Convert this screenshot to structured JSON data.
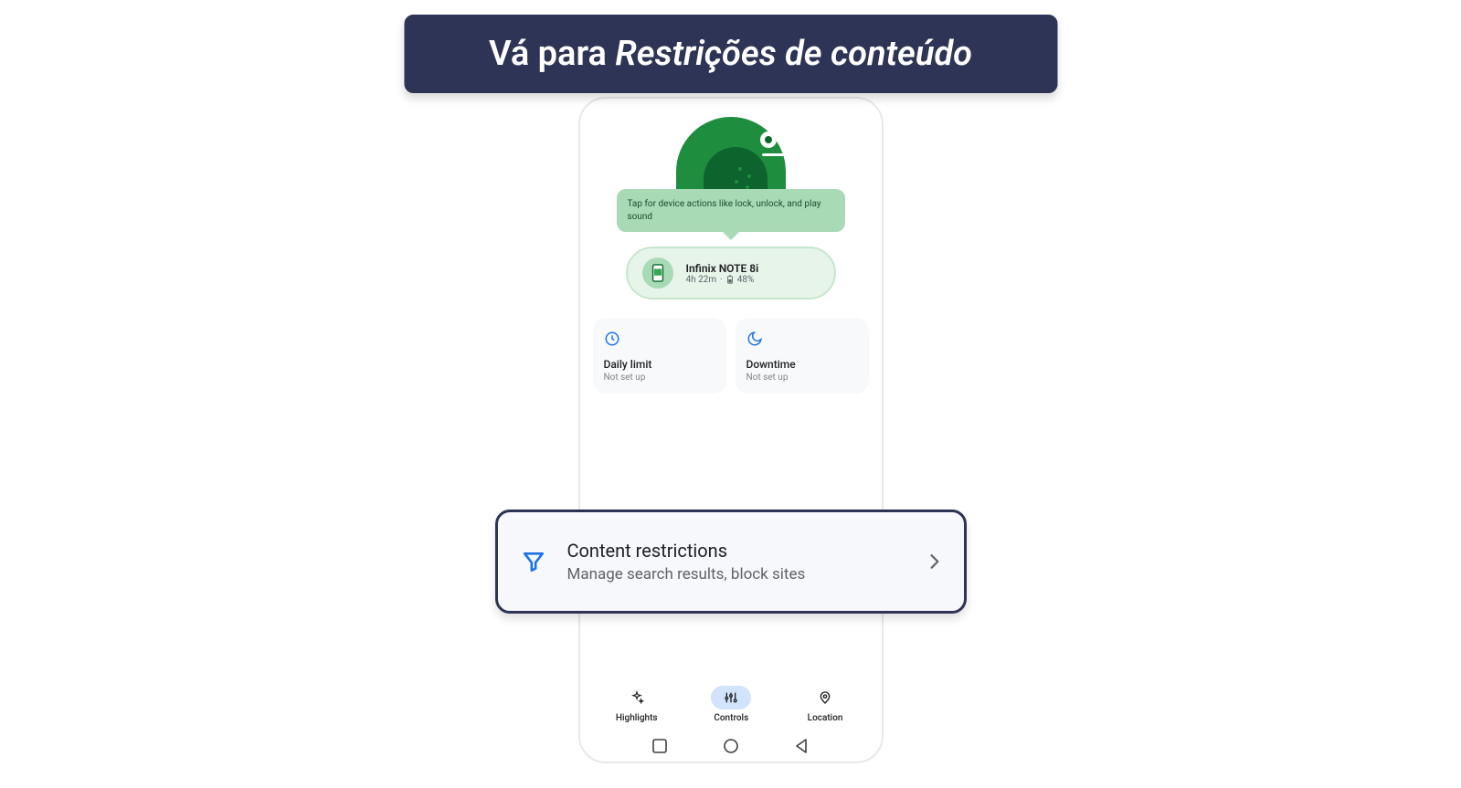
{
  "banner": {
    "prefix": "Vá para ",
    "italic": "Restrições de conteúdo"
  },
  "tooltip": {
    "text": "Tap for device actions like lock, unlock, and play sound"
  },
  "device": {
    "name": "Infinix NOTE 8i",
    "time": "4h 22m",
    "separator": "·",
    "battery": "48%"
  },
  "cards": {
    "daily": {
      "title": "Daily limit",
      "sub": "Not set up"
    },
    "downtime": {
      "title": "Downtime",
      "sub": "Not set up"
    }
  },
  "callout": {
    "title": "Content restrictions",
    "sub": "Manage search results, block sites"
  },
  "nav": {
    "highlights": "Highlights",
    "controls": "Controls",
    "location": "Location"
  }
}
